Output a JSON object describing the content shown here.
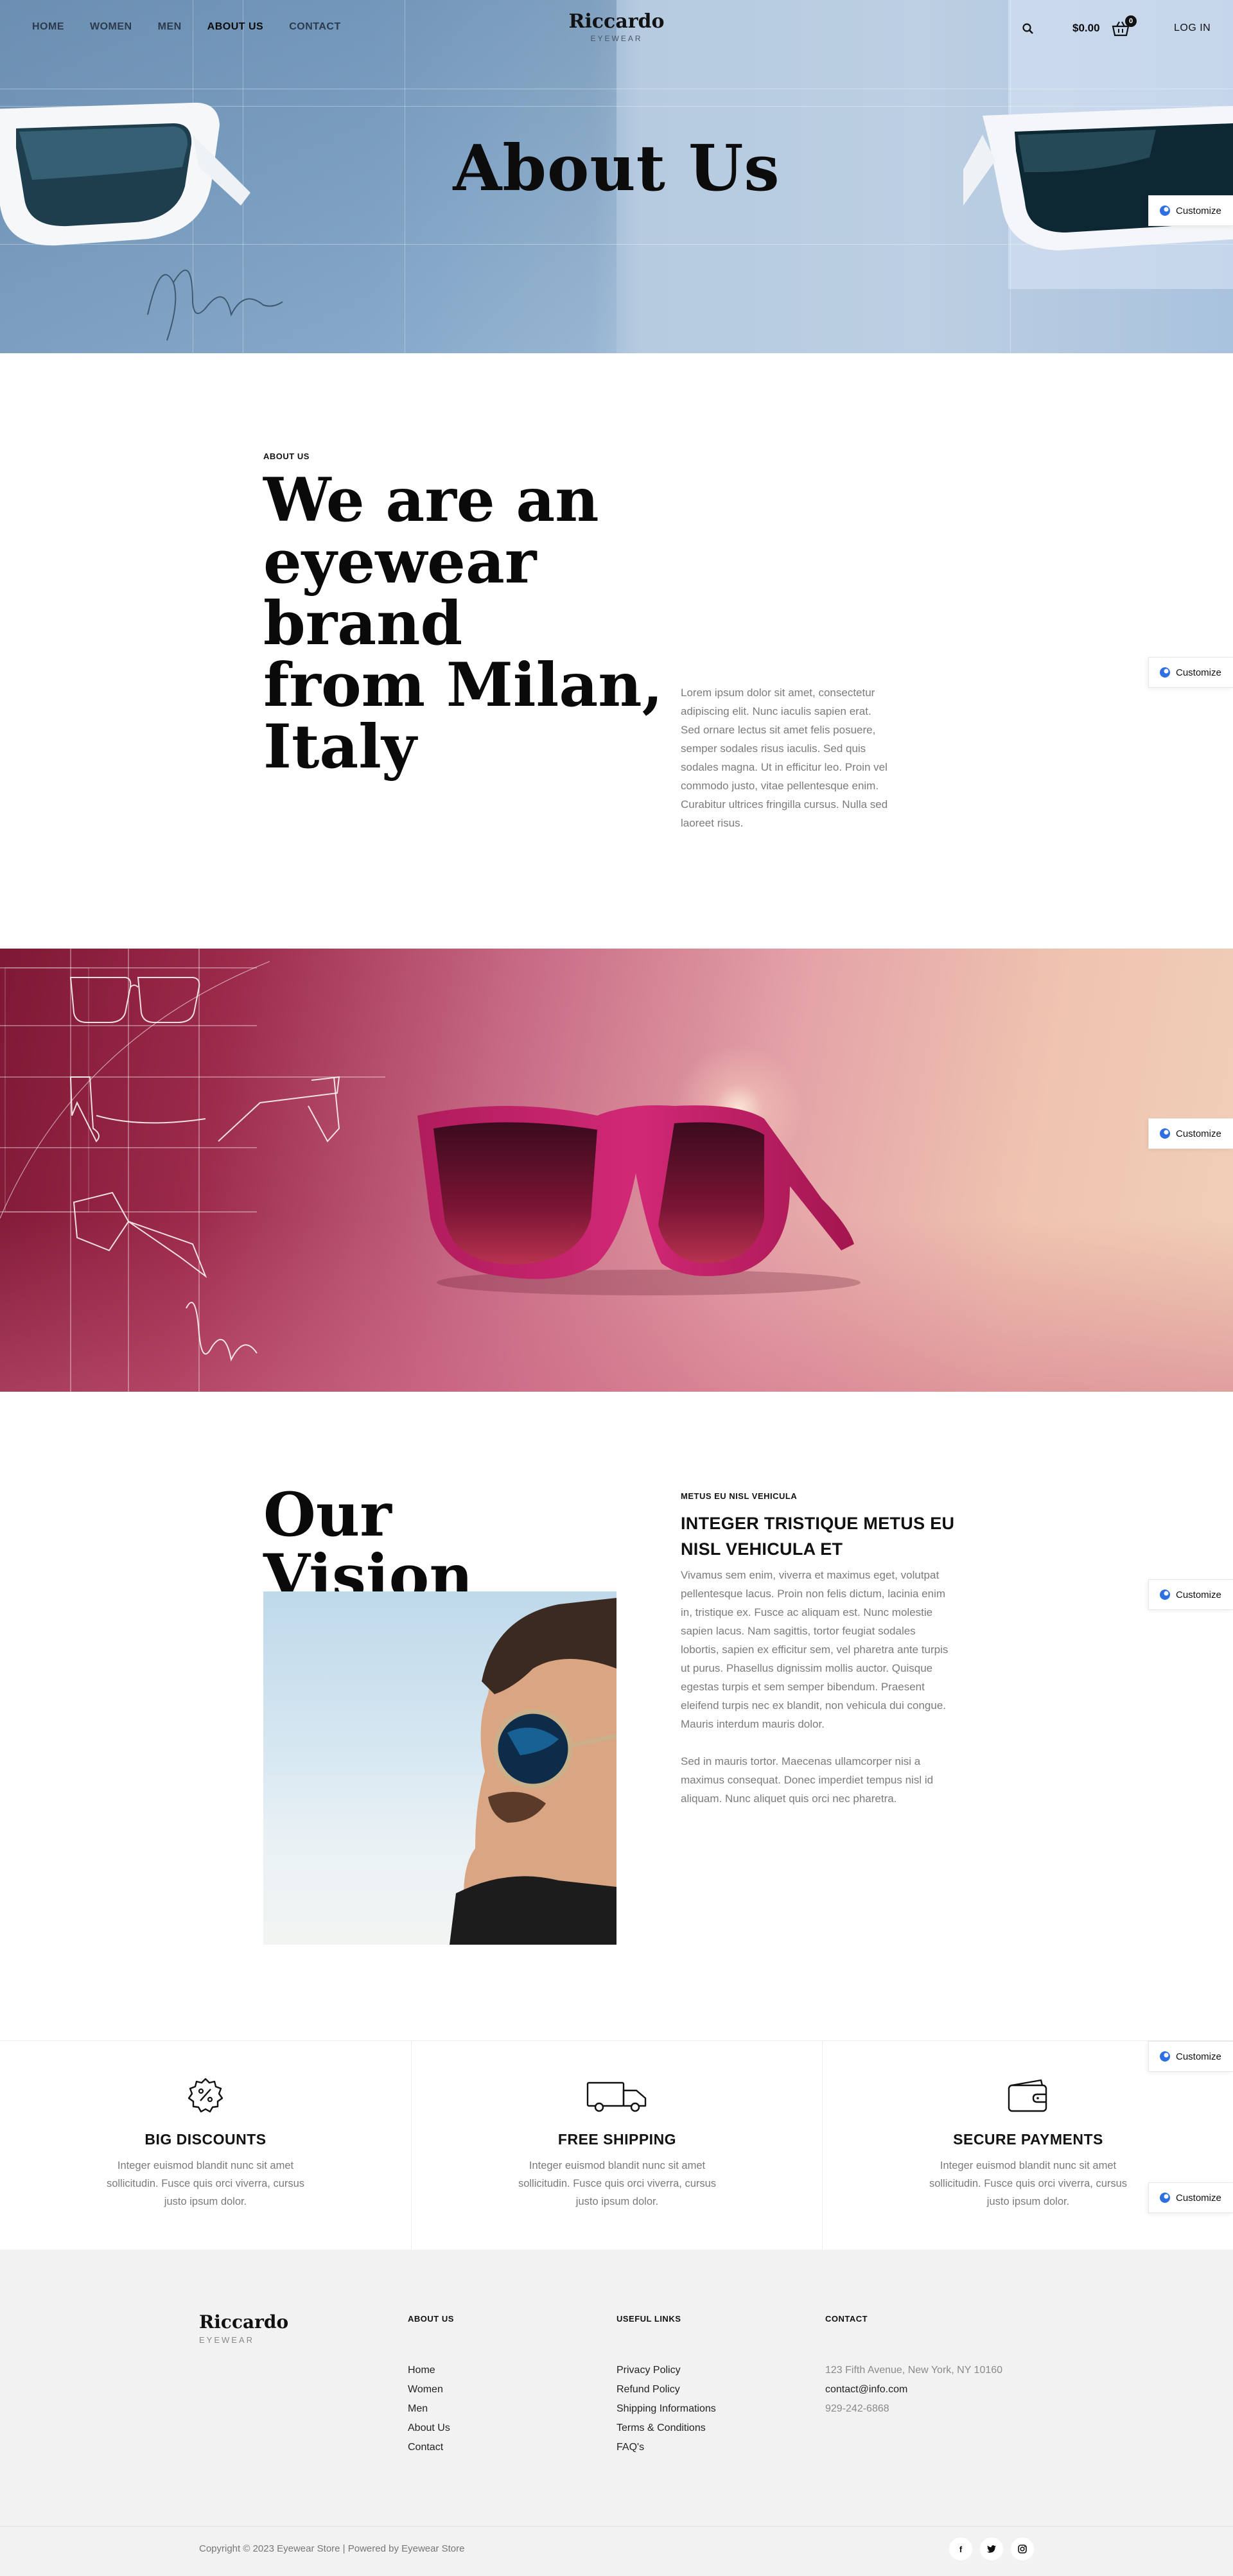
{
  "nav": {
    "links": [
      "HOME",
      "WOMEN",
      "MEN",
      "ABOUT US",
      "CONTACT"
    ],
    "active": "ABOUT US",
    "brand_name": "Riccardo",
    "brand_sub": "EYEWEAR",
    "cart_total": "$0.00",
    "cart_count": "0",
    "login": "LOG IN"
  },
  "hero": {
    "title": "About Us"
  },
  "customize_label": "Customize",
  "intro": {
    "eyebrow": "ABOUT US",
    "heading_lines": [
      "We are an",
      "eyewear brand",
      "from Milan,",
      "Italy"
    ],
    "paragraph_lines": [
      "Lorem ipsum dolor sit amet, consectetur",
      "adipiscing elit. Nunc iaculis sapien erat.",
      "Sed ornare lectus sit amet felis posuere,",
      "semper sodales risus iaculis. Sed quis",
      "sodales magna. Ut in efficitur leo. Proin vel",
      "commodo justo, vitae pellentesque enim.",
      "Curabitur ultrices fringilla cursus. Nulla sed",
      "laoreet risus."
    ]
  },
  "vision": {
    "heading_lines": [
      "Our",
      "Vision"
    ],
    "eyebrow": "METUS EU NISL VEHICULA",
    "title_lines": [
      "INTEGER TRISTIQUE METUS EU",
      "NISL VEHICULA ET"
    ],
    "paragraph1_lines": [
      "Vivamus sem enim, viverra et maximus eget, volutpat",
      "pellentesque lacus. Proin non felis dictum, lacinia enim",
      "in, tristique ex. Fusce ac aliquam est. Nunc molestie",
      "sapien lacus. Nam sagittis, tortor feugiat sodales",
      "lobortis, sapien ex efficitur sem, vel pharetra ante turpis",
      "ut purus. Phasellus dignissim mollis auctor. Quisque",
      "egestas turpis et sem semper bibendum. Praesent",
      "eleifend turpis nec ex blandit, non vehicula dui congue.",
      "Mauris interdum mauris dolor."
    ],
    "paragraph2_lines": [
      "Sed in mauris tortor. Maecenas ullamcorper nisi a",
      "maximus consequat. Donec imperdiet tempus nisl id",
      "aliquam. Nunc aliquet quis orci nec pharetra."
    ]
  },
  "features": [
    {
      "icon": "discount-badge-icon",
      "title": "BIG DISCOUNTS",
      "text_lines": [
        "Integer euismod blandit nunc sit amet",
        "sollicitudin. Fusce quis orci viverra, cursus",
        "justo ipsum dolor."
      ]
    },
    {
      "icon": "delivery-truck-icon",
      "title": "FREE SHIPPING",
      "text_lines": [
        "Integer euismod blandit nunc sit amet",
        "sollicitudin. Fusce quis orci viverra, cursus",
        "justo ipsum dolor."
      ]
    },
    {
      "icon": "wallet-icon",
      "title": "SECURE PAYMENTS",
      "text_lines": [
        "Integer euismod blandit nunc sit amet",
        "sollicitudin. Fusce quis orci viverra, cursus",
        "justo ipsum dolor."
      ]
    }
  ],
  "footer": {
    "brand_name": "Riccardo",
    "brand_sub": "EYEWEAR",
    "about_title": "ABOUT US",
    "about_links": [
      "Home",
      "Women",
      "Men",
      "About Us",
      "Contact"
    ],
    "useful_title": "USEFUL LINKS",
    "useful_links": [
      "Privacy Policy",
      "Refund Policy",
      "Shipping Informations",
      "Terms & Conditions",
      "FAQ's"
    ],
    "contact_title": "CONTACT",
    "contact_address": "123 Fifth Avenue, New York, NY 10160",
    "contact_email": "contact@info.com",
    "contact_phone": "929-242-6868",
    "copyright": "Copyright © 2023 Eyewear Store | Powered by Eyewear Store",
    "socials": [
      {
        "icon": "facebook-icon",
        "glyph": "f"
      },
      {
        "icon": "twitter-icon",
        "glyph": "𝕥"
      },
      {
        "icon": "instagram-icon",
        "glyph": "◎"
      }
    ]
  },
  "colors": {
    "hero_blue": "#9fbbd6",
    "banner_magenta": "#9c2a4a",
    "banner_peach": "#efc4b0",
    "footer_bg": "#f2f2f2",
    "customize_accent": "#2f6fe4"
  }
}
